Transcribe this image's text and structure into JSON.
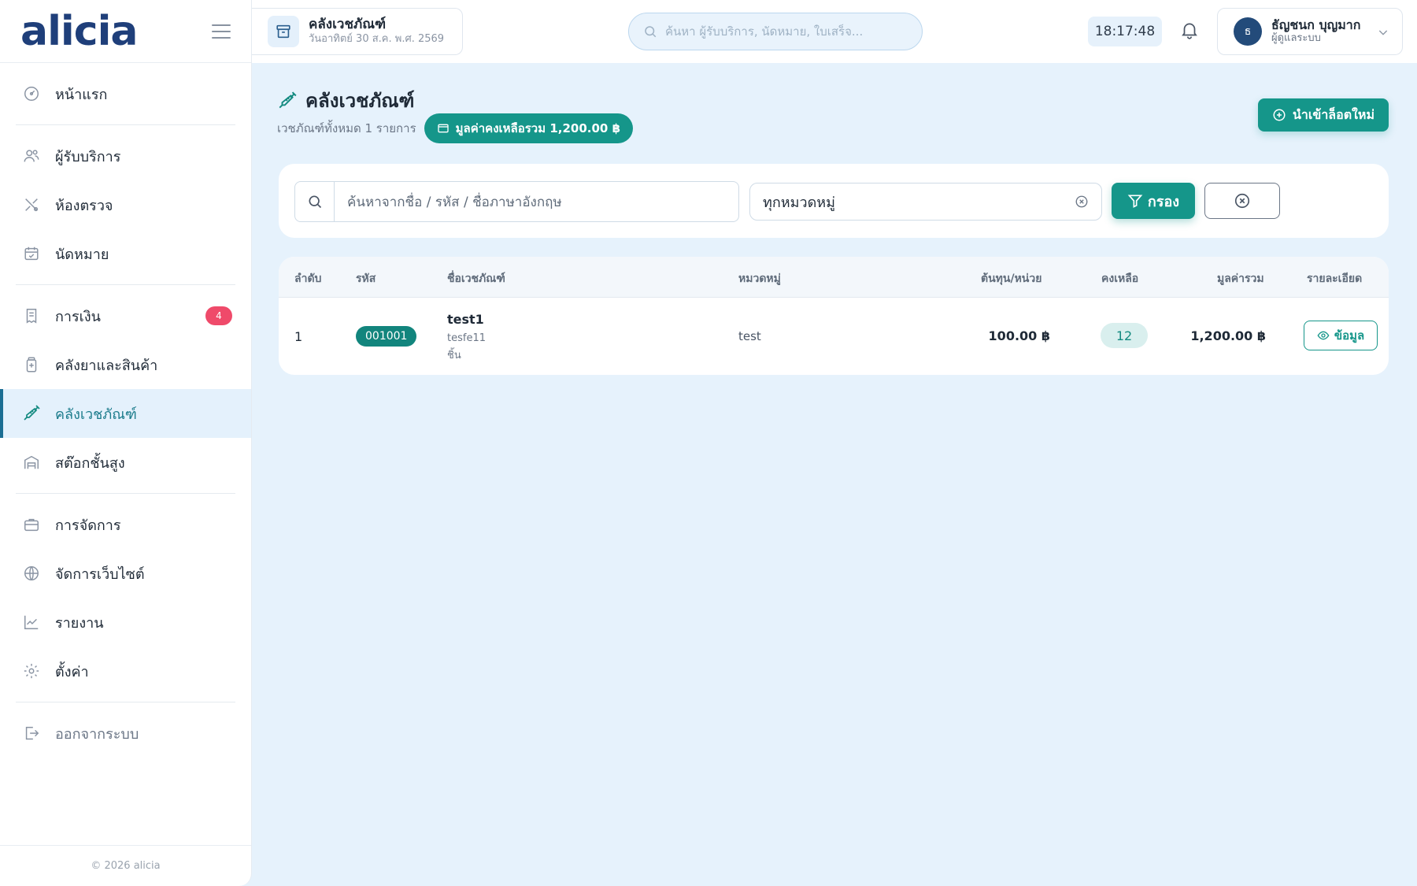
{
  "app": {
    "logo": "alicia"
  },
  "sidebar": {
    "items": [
      {
        "label": "หน้าแรก",
        "icon": "dashboard-gauge-icon"
      },
      {
        "label": "ผู้รับบริการ",
        "icon": "users-icon"
      },
      {
        "label": "ห้องตรวจ",
        "icon": "stethoscope-icon"
      },
      {
        "label": "นัดหมาย",
        "icon": "calendar-check-icon"
      },
      {
        "label": "การเงิน",
        "icon": "receipt-icon",
        "badge": "4"
      },
      {
        "label": "คลังยาและสินค้า",
        "icon": "medicine-bottle-icon"
      },
      {
        "label": "คลังเวชภัณฑ์",
        "icon": "syringe-icon",
        "active": true
      },
      {
        "label": "สต๊อกชั้นสูง",
        "icon": "warehouse-icon"
      },
      {
        "label": "การจัดการ",
        "icon": "briefcase-icon"
      },
      {
        "label": "จัดการเว็บไซต์",
        "icon": "globe-icon"
      },
      {
        "label": "รายงาน",
        "icon": "line-chart-icon"
      },
      {
        "label": "ตั้งค่า",
        "icon": "gear-icon"
      },
      {
        "label": "ออกจากระบบ",
        "icon": "logout-icon"
      }
    ],
    "footer": "© 2026 alicia"
  },
  "topbar": {
    "page_chip": {
      "title": "คลังเวชภัณฑ์",
      "date": "วันอาทิตย์ 30 ส.ค. พ.ศ. 2569"
    },
    "search_placeholder": "ค้นหา ผู้รับบริการ, นัดหมาย, ใบเสร็จ...",
    "clock": "18:17:48",
    "user": {
      "initial": "ธ",
      "name": "ธัญชนก บุญมาก",
      "role": "ผู้ดูแลระบบ"
    }
  },
  "page": {
    "title": "คลังเวชภัณฑ์",
    "subtitle": "เวชภัณฑ์ทั้งหมด 1 รายการ",
    "total_value": "มูลค่าคงเหลือรวม 1,200.00 ฿",
    "import_button": "นำเข้าล็อตใหม่"
  },
  "filter": {
    "search_placeholder": "ค้นหาจากชื่อ / รหัส / ชื่อภาษาอังกฤษ",
    "category_value": "ทุกหมวดหมู่",
    "filter_button": "กรอง"
  },
  "table": {
    "headers": [
      "ลำดับ",
      "รหัส",
      "ชื่อเวชภัณฑ์",
      "หมวดหมู่",
      "ต้นทุน/หน่วย",
      "คงเหลือ",
      "มูลค่ารวม",
      "รายละเอียด"
    ],
    "rows": [
      {
        "index": "1",
        "code": "001001",
        "name": "test1",
        "name_en": "tesfe11",
        "unit": "ชิ้น",
        "category": "test",
        "unit_cost": "100.00 ฿",
        "remaining": "12",
        "total": "1,200.00 ฿",
        "detail_label": "ข้อมูล"
      }
    ]
  },
  "colors": {
    "primary": "#15968a",
    "brand": "#1f3f7a",
    "badge": "#ef4a6a",
    "background": "#e6f2fc"
  }
}
